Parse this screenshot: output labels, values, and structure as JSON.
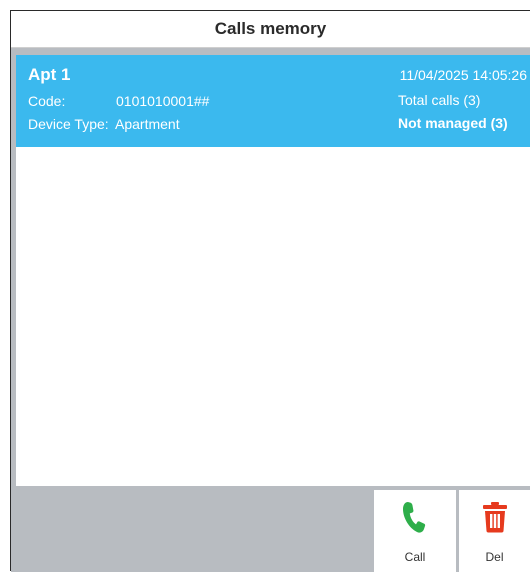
{
  "title": "Calls memory",
  "calls": [
    {
      "name": "Apt 1",
      "code_label": "Code:",
      "code_value": "0101010001##",
      "device_type_label": "Device Type:",
      "device_type_value": "Apartment",
      "datetime": "11/04/2025 14:05:26",
      "total_calls": "Total calls (3)",
      "status": "Not managed (3)"
    }
  ],
  "actions": {
    "call": {
      "label": "Call",
      "icon": "phone-icon",
      "color": "#2eae4a"
    },
    "del": {
      "label": "Del",
      "icon": "trash-icon",
      "color": "#e63a1e"
    }
  },
  "colors": {
    "selected_row": "#3bb9ee",
    "panel_gray": "#b8bcc1"
  }
}
